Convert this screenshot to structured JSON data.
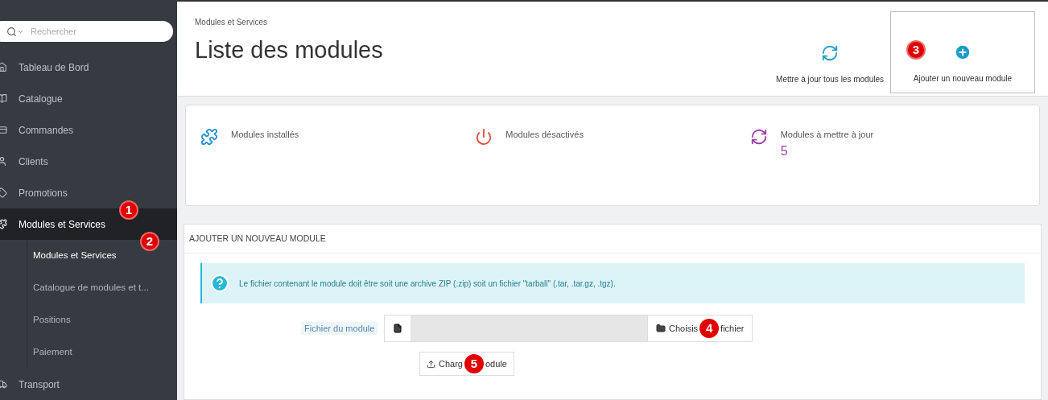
{
  "sidebar": {
    "search": {
      "placeholder": "Rechercher"
    },
    "items": [
      {
        "label": "Tableau de Bord",
        "selected": false
      },
      {
        "label": "Catalogue",
        "selected": false
      },
      {
        "label": "Commandes",
        "selected": false
      },
      {
        "label": "Clients",
        "selected": false
      },
      {
        "label": "Promotions",
        "selected": false
      },
      {
        "label": "Modules et Services",
        "selected": true,
        "badge": "1",
        "children": [
          {
            "label": "Modules et Services",
            "selected": true,
            "badge": "2"
          },
          {
            "label": "Catalogue de modules et t...",
            "selected": false
          },
          {
            "label": "Positions",
            "selected": false
          },
          {
            "label": "Paiement",
            "selected": false
          }
        ]
      },
      {
        "label": "Transport",
        "selected": false
      }
    ]
  },
  "header": {
    "breadcrumb": "Modules et Services",
    "title": "Liste des modules",
    "actions": [
      {
        "kind": "refresh",
        "label": "Mettre à jour tous les modules"
      },
      {
        "kind": "add",
        "label": "Ajouter un nouveau module",
        "badge": "3"
      }
    ]
  },
  "stats": [
    {
      "kind": "puzzle",
      "label": "Modules installés"
    },
    {
      "kind": "power",
      "label": "Modules désactivés"
    },
    {
      "kind": "refresh",
      "label": "Modules à mettre à jour",
      "value": "5"
    }
  ],
  "add_panel": {
    "heading": "AJOUTER UN NOUVEAU MODULE",
    "info": "Le fichier contenant le module doit être soit une archive ZIP (.zip) soit un fichier \"tarball\" (.tar, .tar.gz, .tgz).",
    "file_label": "Fichier du module",
    "choose_button": {
      "parts": [
        "Choisis",
        "fichier"
      ],
      "badge": "4"
    },
    "upload_button": {
      "parts": [
        "Charg",
        "odule"
      ],
      "badge": "5"
    }
  }
}
